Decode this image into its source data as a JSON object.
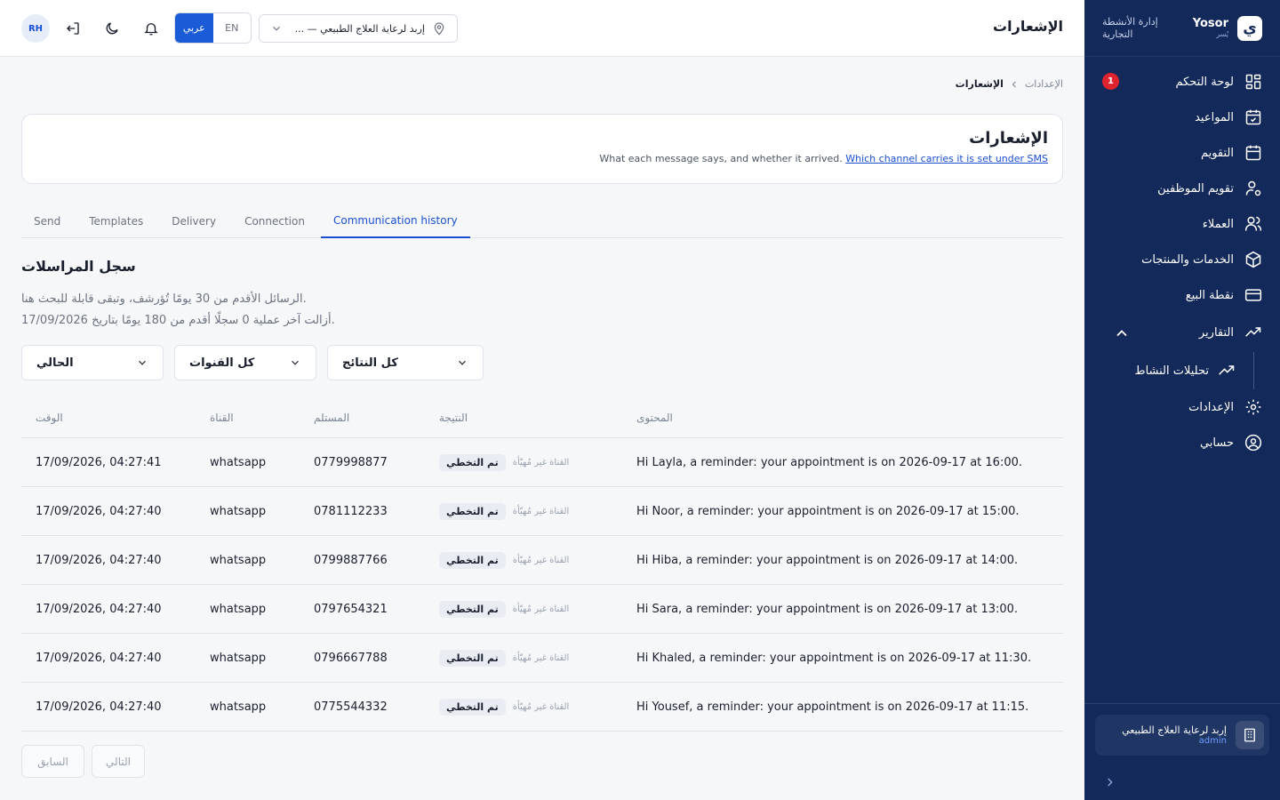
{
  "sidebar": {
    "brand_name": "Yosor",
    "brand_sub": "يُسر",
    "brand_tag_line1": "إدارة الأنشطة",
    "brand_tag_line2": "التجارية",
    "items": [
      {
        "label": "لوحة التحكم",
        "icon": "dashboard-icon",
        "badge": "1"
      },
      {
        "label": "المواعيد",
        "icon": "calendar-check-icon"
      },
      {
        "label": "التقويم",
        "icon": "calendar-icon"
      },
      {
        "label": "تقويم الموظفين",
        "icon": "user-cog-icon"
      },
      {
        "label": "العملاء",
        "icon": "users-icon"
      },
      {
        "label": "الخدمات والمنتجات",
        "icon": "box-icon"
      },
      {
        "label": "نقطة البيع",
        "icon": "card-icon"
      },
      {
        "label": "التقارير",
        "icon": "trend-icon"
      },
      {
        "label": "تحليلات النشاط",
        "icon": "trend-icon"
      },
      {
        "label": "الإعدادات",
        "icon": "gear-icon"
      },
      {
        "label": "حسابي",
        "icon": "user-circle-icon"
      }
    ],
    "org_name": "إربد لرعاية العلاج الطبيعي",
    "org_role": "admin"
  },
  "topbar": {
    "title": "الإشعارات",
    "avatar": "RH",
    "lang_en": "EN",
    "lang_ar": "عربي",
    "branch": "إربد لرعاية العلاج الطبيعي — ..."
  },
  "breadcrumb": {
    "parent": "الإعدادات",
    "current": "الإشعارات"
  },
  "header": {
    "title": "الإشعارات",
    "desc_text": "What each message says, and whether it arrived.",
    "desc_link": "Which channel carries it is set under SMS"
  },
  "tabs": [
    "Send",
    "Templates",
    "Delivery",
    "Connection",
    "Communication history"
  ],
  "section": {
    "title": "سجل المراسلات",
    "note1": "الرسائل الأقدم من 30 يومًا تُؤرشف، وتبقى قابلة للبحث هنا.",
    "note2": "أزالت آخر عملية 0 سجلًا أقدم من 180 يومًا بتاريخ 17/09/2026."
  },
  "filters": {
    "period": "الحالي",
    "channels": "كل القنوات",
    "results": "كل النتائج"
  },
  "table": {
    "headers": {
      "time": "الوقت",
      "channel": "القناة",
      "recipient": "المستلم",
      "result": "النتيجة",
      "content": "المحتوى"
    },
    "rows": [
      {
        "time": "17/09/2026, 04:27:41",
        "channel": "whatsapp",
        "recipient": "0779998877",
        "status": "تم التخطي",
        "reason": "القناة غير مُهيّأة",
        "content": "Hi Layla, a reminder: your appointment is on 2026-09-17 at 16:00."
      },
      {
        "time": "17/09/2026, 04:27:40",
        "channel": "whatsapp",
        "recipient": "0781112233",
        "status": "تم التخطي",
        "reason": "القناة غير مُهيّأة",
        "content": "Hi Noor, a reminder: your appointment is on 2026-09-17 at 15:00."
      },
      {
        "time": "17/09/2026, 04:27:40",
        "channel": "whatsapp",
        "recipient": "0799887766",
        "status": "تم التخطي",
        "reason": "القناة غير مُهيّأة",
        "content": "Hi Hiba, a reminder: your appointment is on 2026-09-17 at 14:00."
      },
      {
        "time": "17/09/2026, 04:27:40",
        "channel": "whatsapp",
        "recipient": "0797654321",
        "status": "تم التخطي",
        "reason": "القناة غير مُهيّأة",
        "content": "Hi Sara, a reminder: your appointment is on 2026-09-17 at 13:00."
      },
      {
        "time": "17/09/2026, 04:27:40",
        "channel": "whatsapp",
        "recipient": "0796667788",
        "status": "تم التخطي",
        "reason": "القناة غير مُهيّأة",
        "content": "Hi Khaled, a reminder: your appointment is on 2026-09-17 at 11:30."
      },
      {
        "time": "17/09/2026, 04:27:40",
        "channel": "whatsapp",
        "recipient": "0775544332",
        "status": "تم التخطي",
        "reason": "القناة غير مُهيّأة",
        "content": "Hi Yousef, a reminder: your appointment is on 2026-09-17 at 11:15."
      }
    ]
  },
  "pager": {
    "prev": "السابق",
    "next": "التالي"
  },
  "colors": {
    "sidebar": "#12295a",
    "accent": "#1a5cd8",
    "badge": "#e0242f"
  }
}
